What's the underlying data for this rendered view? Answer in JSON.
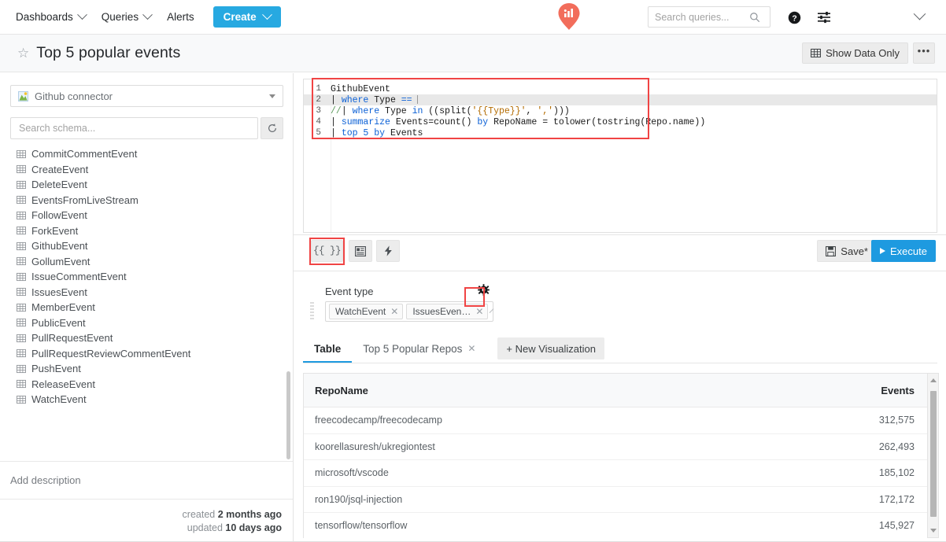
{
  "topnav": {
    "items": [
      {
        "label": "Dashboards",
        "has_caret": true
      },
      {
        "label": "Queries",
        "has_caret": true
      },
      {
        "label": "Alerts",
        "has_caret": false
      }
    ],
    "create_label": "Create",
    "search": {
      "value": "",
      "placeholder": "Search queries..."
    },
    "logo_name": "app-logo",
    "logo_color": "#f26d5b"
  },
  "titlebar": {
    "title": "Top 5 popular events",
    "show_data_only": "Show Data Only",
    "more_label": "•••"
  },
  "sidebar": {
    "connector": "Github connector",
    "search": {
      "value": "",
      "placeholder": "Search schema..."
    },
    "tables": [
      "CommitCommentEvent",
      "CreateEvent",
      "DeleteEvent",
      "EventsFromLiveStream",
      "FollowEvent",
      "ForkEvent",
      "GithubEvent",
      "GollumEvent",
      "IssueCommentEvent",
      "IssuesEvent",
      "MemberEvent",
      "PublicEvent",
      "PullRequestEvent",
      "PullRequestReviewCommentEvent",
      "PushEvent",
      "ReleaseEvent",
      "WatchEvent"
    ],
    "description_placeholder": "Add description",
    "created_prefix": "created",
    "created_value": "2 months ago",
    "updated_prefix": "updated",
    "updated_value": "10 days ago"
  },
  "editor": {
    "lines": [
      {
        "n": "1",
        "active": false,
        "tokens": [
          {
            "t": "GithubEvent",
            "c": "code-text"
          }
        ]
      },
      {
        "n": "2",
        "active": true,
        "tokens": [
          {
            "t": "| ",
            "c": "code-text"
          },
          {
            "t": "where ",
            "c": "kw"
          },
          {
            "t": "Type ",
            "c": "code-text"
          },
          {
            "t": "== ",
            "c": "kw"
          }
        ],
        "cursor": true
      },
      {
        "n": "3",
        "active": false,
        "tokens": [
          {
            "t": "//",
            "c": "cm"
          },
          {
            "t": "| ",
            "c": "code-text"
          },
          {
            "t": "where ",
            "c": "kw"
          },
          {
            "t": "Type ",
            "c": "code-text"
          },
          {
            "t": "in ",
            "c": "kw"
          },
          {
            "t": "((split(",
            "c": "code-text"
          },
          {
            "t": "'{{Type}}'",
            "c": "str"
          },
          {
            "t": ", ",
            "c": "code-text"
          },
          {
            "t": "','",
            "c": "str"
          },
          {
            "t": ")))",
            "c": "code-text"
          }
        ]
      },
      {
        "n": "4",
        "active": false,
        "tokens": [
          {
            "t": "| ",
            "c": "code-text"
          },
          {
            "t": "summarize ",
            "c": "kw"
          },
          {
            "t": "Events=count() ",
            "c": "code-text"
          },
          {
            "t": "by ",
            "c": "kw"
          },
          {
            "t": "RepoName = tolower(tostring(Repo.name))",
            "c": "code-text"
          }
        ]
      },
      {
        "n": "5",
        "active": false,
        "tokens": [
          {
            "t": "| ",
            "c": "code-text"
          },
          {
            "t": "top ",
            "c": "kw"
          },
          {
            "t": "5 ",
            "c": "num"
          },
          {
            "t": "by ",
            "c": "kw"
          },
          {
            "t": "Events",
            "c": "code-text"
          }
        ]
      }
    ],
    "toolbar": {
      "params_label": "{{ }}",
      "panel_icon": "form-panel-icon",
      "bolt_icon": "lightning-bolt-icon",
      "save_label": "Save*",
      "execute_label": "Execute"
    }
  },
  "params": {
    "label": "Event type",
    "gear_icon": "gear-icon",
    "tags": [
      "WatchEvent",
      "IssuesEven…"
    ]
  },
  "viz": {
    "tabs": [
      {
        "label": "Table",
        "active": true,
        "closable": false
      },
      {
        "label": "Top 5 Popular Repos",
        "active": false,
        "closable": true
      }
    ],
    "new_visualization": "+ New Visualization"
  },
  "chart_data": {
    "type": "table",
    "title": "Top 5 popular events",
    "columns": [
      "RepoName",
      "Events"
    ],
    "categories": [
      "freecodecamp/freecodecamp",
      "koorellasuresh/ukregiontest",
      "microsoft/vscode",
      "ron190/jsql-injection",
      "tensorflow/tensorflow"
    ],
    "values": [
      312575,
      262493,
      185102,
      172172,
      145927
    ],
    "value_labels": [
      "312,575",
      "262,493",
      "185,102",
      "172,172",
      "145,927"
    ],
    "xlabel": "RepoName",
    "ylabel": "Events",
    "rows": [
      {
        "RepoName": "freecodecamp/freecodecamp",
        "Events": "312,575"
      },
      {
        "RepoName": "koorellasuresh/ukregiontest",
        "Events": "262,493"
      },
      {
        "RepoName": "microsoft/vscode",
        "Events": "185,102"
      },
      {
        "RepoName": "ron190/jsql-injection",
        "Events": "172,172"
      },
      {
        "RepoName": "tensorflow/tensorflow",
        "Events": "145,927"
      }
    ]
  },
  "annotations": {
    "highlight_color": "#f04444",
    "boxes": [
      "query-editor-box",
      "params-toolbar-button-box",
      "params-gear-box"
    ]
  }
}
